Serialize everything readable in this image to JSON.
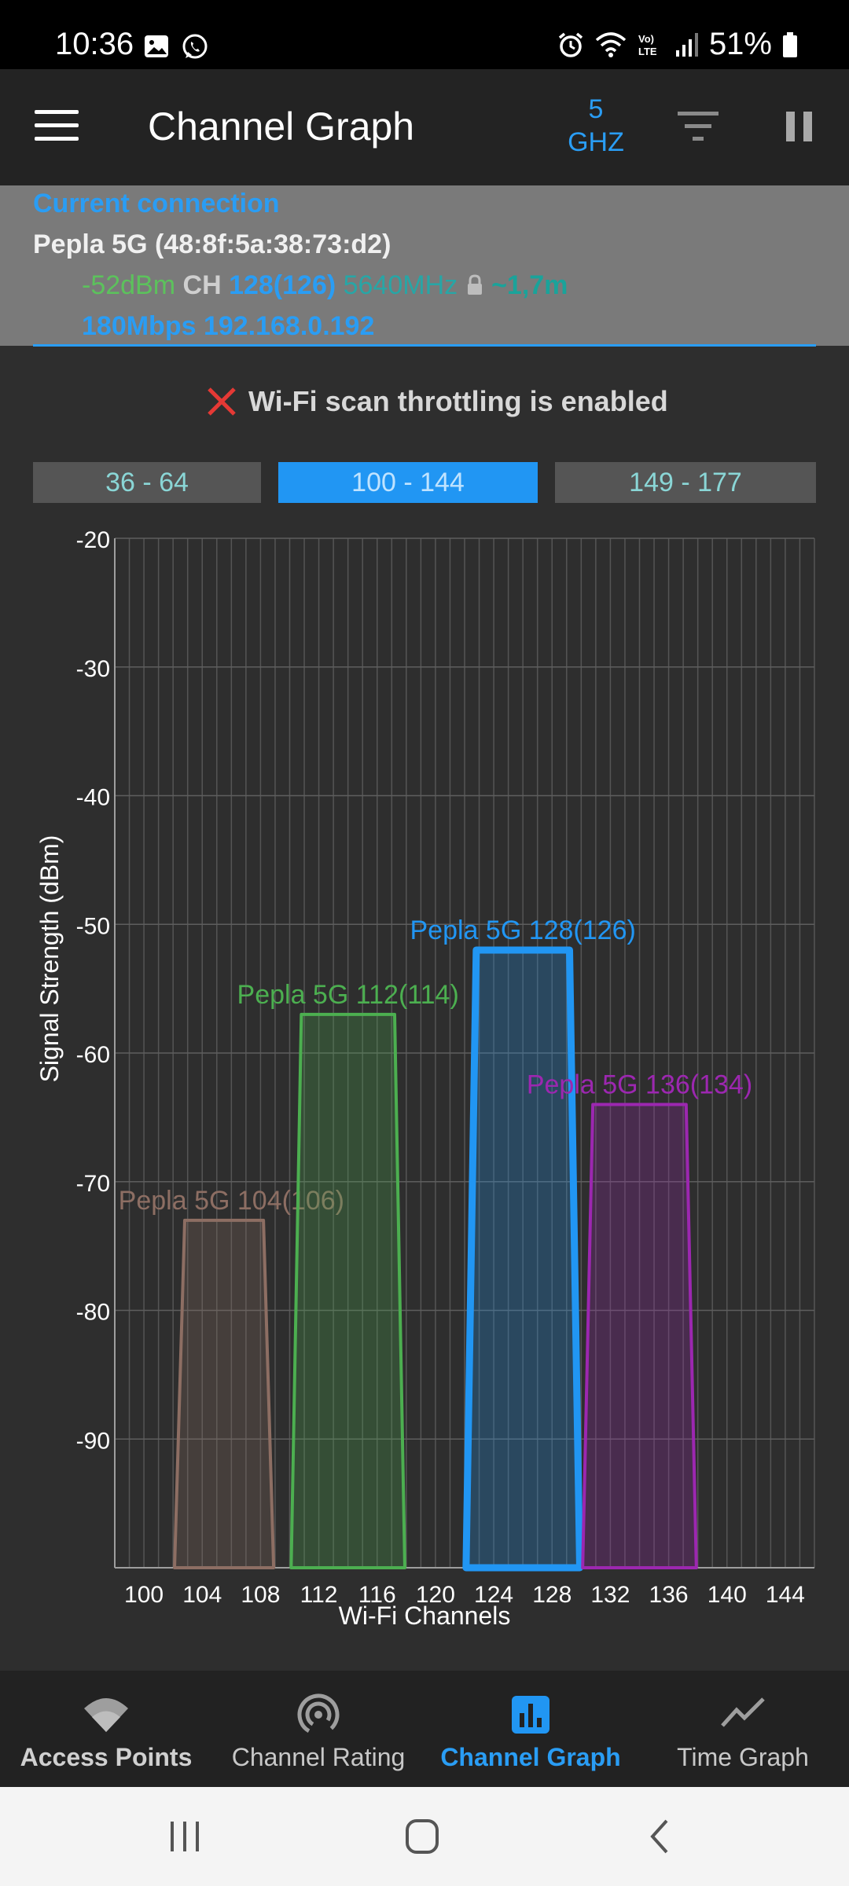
{
  "status_bar": {
    "time": "10:36",
    "battery": "51%",
    "icons": [
      "gallery-icon",
      "whatsapp-icon",
      "alarm-icon",
      "wifi-icon",
      "volte-icon",
      "signal-icon",
      "battery-icon"
    ]
  },
  "app_bar": {
    "title": "Channel Graph",
    "band_line1": "5",
    "band_line2": "GHZ",
    "icons": [
      "menu-icon",
      "filter-icon",
      "pause-icon"
    ]
  },
  "connection": {
    "title": "Current connection",
    "name": "Pepla 5G (48:8f:5a:38:73:d2)",
    "signal": "-52dBm",
    "ch_label": "CH",
    "channel": "128(126)",
    "frequency": "5640MHz",
    "distance": "~1,7m",
    "speed_ip": "180Mbps 192.168.0.192"
  },
  "warning": {
    "text": "Wi-Fi scan throttling is enabled"
  },
  "ranges": [
    {
      "label": "36 - 64",
      "active": false
    },
    {
      "label": "100 - 144",
      "active": true
    },
    {
      "label": "149 - 177",
      "active": false
    }
  ],
  "chart_data": {
    "type": "area",
    "xlabel": "Wi-Fi Channels",
    "ylabel": "Signal Strength (dBm)",
    "ylim": [
      -100,
      -20
    ],
    "xlim": [
      98,
      146
    ],
    "y_ticks": [
      -20,
      -30,
      -40,
      -50,
      -60,
      -70,
      -80,
      -90
    ],
    "x_ticks": [
      100,
      104,
      108,
      112,
      116,
      120,
      124,
      128,
      132,
      136,
      140,
      144
    ],
    "series": [
      {
        "name": "Pepla 5G 104(106)",
        "color": "#8d6e63",
        "center": 106,
        "signal": -73,
        "x_bottom": [
          102.1,
          108.9
        ],
        "x_top": [
          102.8,
          108.2
        ]
      },
      {
        "name": "Pepla 5G 112(114)",
        "color": "#4caf50",
        "center": 114,
        "signal": -57,
        "x_bottom": [
          110.1,
          117.9
        ],
        "x_top": [
          110.8,
          117.2
        ]
      },
      {
        "name": "Pepla 5G 128(126)",
        "color": "#2196f3",
        "center": 126,
        "signal": -52,
        "x_bottom": [
          122.1,
          129.9
        ],
        "x_top": [
          122.8,
          129.2
        ]
      },
      {
        "name": "Pepla 5G 136(134)",
        "color": "#9c27b0",
        "center": 134,
        "signal": -64,
        "x_bottom": [
          130.1,
          137.9
        ],
        "x_top": [
          130.8,
          137.2
        ]
      }
    ]
  },
  "bottom_nav": [
    {
      "label": "Access Points",
      "icon": "wifi-icon"
    },
    {
      "label": "Channel Rating",
      "icon": "antenna-icon"
    },
    {
      "label": "Channel Graph",
      "icon": "bar-chart-icon",
      "active": true
    },
    {
      "label": "Time Graph",
      "icon": "line-chart-icon"
    }
  ],
  "system_nav": [
    "recents-icon",
    "home-icon",
    "back-icon"
  ]
}
